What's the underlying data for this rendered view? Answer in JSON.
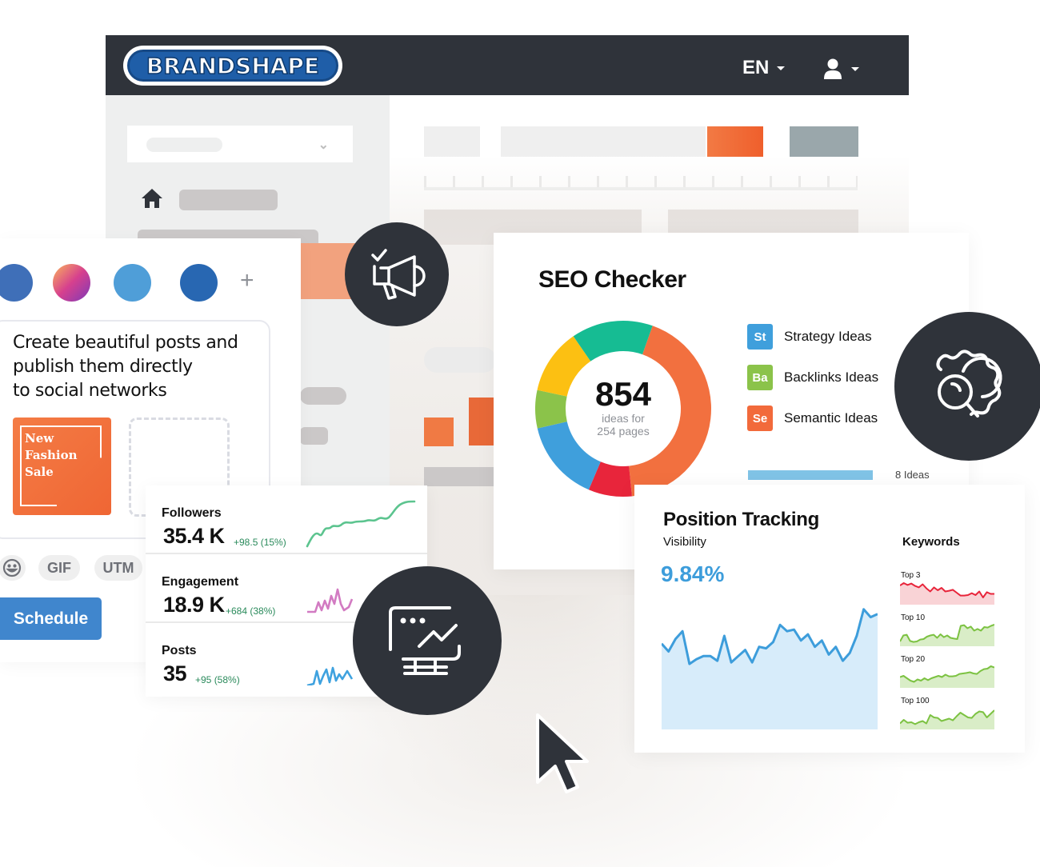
{
  "app": {
    "logo_text": "BRANDSHAPE",
    "language": "EN",
    "icons": {
      "language_caret": "caret-down-icon",
      "user": "user-icon",
      "user_caret": "caret-down-icon",
      "home": "home-icon"
    }
  },
  "post_composer": {
    "networks": [
      {
        "name": "facebook",
        "color": "#3f6fb8"
      },
      {
        "name": "instagram",
        "color": "#d6408e"
      },
      {
        "name": "twitter",
        "color": "#4f9ed8"
      },
      {
        "name": "linkedin",
        "color": "#2867b2"
      }
    ],
    "add_network_label": "+",
    "text": "Create beautiful posts and publish them directly to social networks",
    "text_lines": [
      "Create beautiful posts and",
      "publish them directly",
      "to social networks"
    ],
    "image_text_lines": [
      "New",
      "Fashion",
      "Sale"
    ],
    "chips": {
      "emoji": "emoji-icon",
      "gif": "GIF",
      "utm": "UTM"
    },
    "schedule_label": "Schedule"
  },
  "social_stats": [
    {
      "label": "Followers",
      "value": "35.4 K",
      "delta": "+98.5 (15%)",
      "color": "#5cc48f"
    },
    {
      "label": "Engagement",
      "value": "18.9 K",
      "delta": "+684 (38%)",
      "color": "#d27bc2"
    },
    {
      "label": "Posts",
      "value": "35",
      "delta": "+95 (58%)",
      "color": "#3fa2df"
    }
  ],
  "badges": [
    "megaphone-check-icon",
    "monitor-chart-icon",
    "gear-search-icon"
  ],
  "seo_checker": {
    "title": "SEO Checker",
    "total": "854",
    "subtitle_line1": "ideas for",
    "subtitle_line2": "254 pages",
    "legend": [
      {
        "abbr": "St",
        "label": "Strategy Ideas",
        "color": "#3f9fdc"
      },
      {
        "abbr": "Ba",
        "label": "Backlinks Ideas",
        "color": "#8bc34a"
      },
      {
        "abbr": "Se",
        "label": "Semantic Ideas",
        "color": "#f26a3b"
      }
    ],
    "bar_label": "8 Ideas",
    "donut_segments": [
      {
        "name": "orange",
        "value": 43,
        "color": "#f2703f"
      },
      {
        "name": "red",
        "value": 8,
        "color": "#e8253b"
      },
      {
        "name": "blue",
        "value": 15,
        "color": "#3f9fdc"
      },
      {
        "name": "light-green",
        "value": 7,
        "color": "#8bc34a"
      },
      {
        "name": "yellow",
        "value": 12,
        "color": "#fcc012"
      },
      {
        "name": "teal",
        "value": 15,
        "color": "#16bc93"
      }
    ]
  },
  "position_tracking": {
    "title": "Position Tracking",
    "visibility_label": "Visibility",
    "visibility_value": "9.84%",
    "keywords_title": "Keywords",
    "visibility_series": [
      55,
      50,
      58,
      63,
      42,
      45,
      47,
      47,
      44,
      60,
      43,
      47,
      51,
      43,
      53,
      52,
      56,
      67,
      63,
      64,
      57,
      61,
      53,
      57,
      48,
      53,
      44,
      49,
      60,
      77,
      72,
      74
    ],
    "keyword_series": [
      {
        "label": "Top 3",
        "color": "#e8253b",
        "fill": "#f9d3d6",
        "values": [
          80,
          90,
          82,
          88,
          78,
          72,
          85,
          68,
          55,
          72,
          60,
          70,
          55,
          58,
          62,
          50,
          38,
          38,
          40,
          48,
          40,
          55,
          30,
          52,
          45,
          45
        ]
      },
      {
        "label": "Top 10",
        "color": "#7cc242",
        "fill": "#d9edc7",
        "values": [
          20,
          45,
          48,
          22,
          18,
          20,
          28,
          30,
          40,
          45,
          48,
          35,
          50,
          38,
          45,
          35,
          32,
          30,
          85,
          88,
          75,
          82,
          65,
          72,
          65,
          80,
          78,
          85,
          90
        ]
      },
      {
        "label": "Top 20",
        "color": "#7cc242",
        "fill": "#d9edc7",
        "values": [
          45,
          50,
          40,
          30,
          25,
          35,
          30,
          40,
          32,
          40,
          45,
          50,
          45,
          55,
          48,
          48,
          50,
          58,
          60,
          62,
          65,
          60,
          58,
          70,
          78,
          80,
          90,
          85
        ]
      },
      {
        "label": "Top 100",
        "color": "#7cc242",
        "fill": "#d9edc7",
        "values": [
          25,
          40,
          28,
          30,
          22,
          30,
          35,
          25,
          60,
          50,
          48,
          35,
          40,
          45,
          38,
          55,
          70,
          60,
          50,
          48,
          65,
          75,
          72,
          50,
          65,
          80
        ]
      }
    ]
  }
}
